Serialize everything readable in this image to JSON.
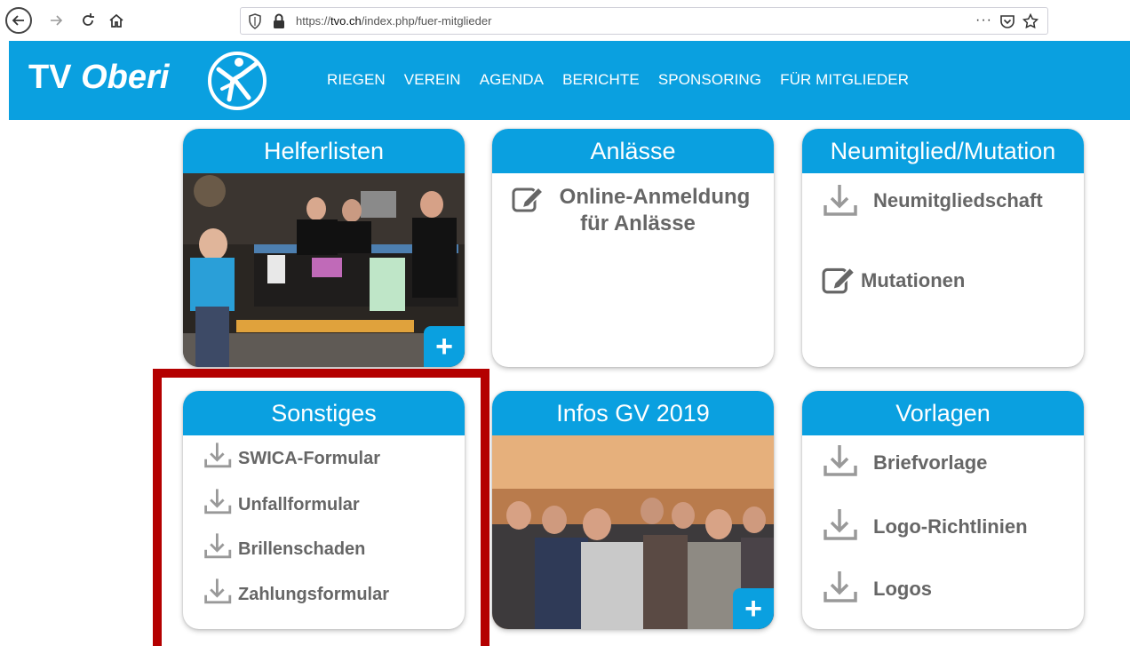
{
  "browser": {
    "url_prefix": "https://",
    "url_domain": "tvo.ch",
    "url_path": "/index.php/fuer-mitglieder",
    "more_label": "···"
  },
  "site": {
    "logo_tv": "TV",
    "logo_oberi": "Oberi",
    "nav": [
      "RIEGEN",
      "VEREIN",
      "AGENDA",
      "BERICHTE",
      "SPONSORING",
      "FÜR MITGLIEDER"
    ]
  },
  "cards": {
    "helferlisten": {
      "title": "Helferlisten",
      "plus": "+"
    },
    "anlaesse": {
      "title": "Anlässe",
      "link_line1": "Online-Anmeldung",
      "link_line2": "für Anlässe"
    },
    "neumitglied": {
      "title": "Neumitglied/Mutation",
      "link1": "Neumitgliedschaft",
      "link2": "Mutationen"
    },
    "sonstiges": {
      "title": "Sonstiges",
      "links": [
        "SWICA-Formular",
        "Unfallformular",
        "Brillenschaden",
        "Zahlungsformular"
      ]
    },
    "infos_gv": {
      "title": "Infos GV 2019",
      "plus": "+"
    },
    "vorlagen": {
      "title": "Vorlagen",
      "links": [
        "Briefvorlage",
        "Logo-Richtlinien",
        "Logos"
      ]
    }
  },
  "colors": {
    "brand_blue": "#0aa0e0",
    "highlight_red": "#b40000",
    "link_gray": "#666666"
  },
  "icons": [
    "back-icon",
    "forward-icon",
    "reload-icon",
    "home-icon",
    "shield-icon",
    "lock-icon",
    "pocket-icon",
    "star-icon",
    "download-icon",
    "edit-icon",
    "plus-icon",
    "gymnast-emblem-icon"
  ]
}
